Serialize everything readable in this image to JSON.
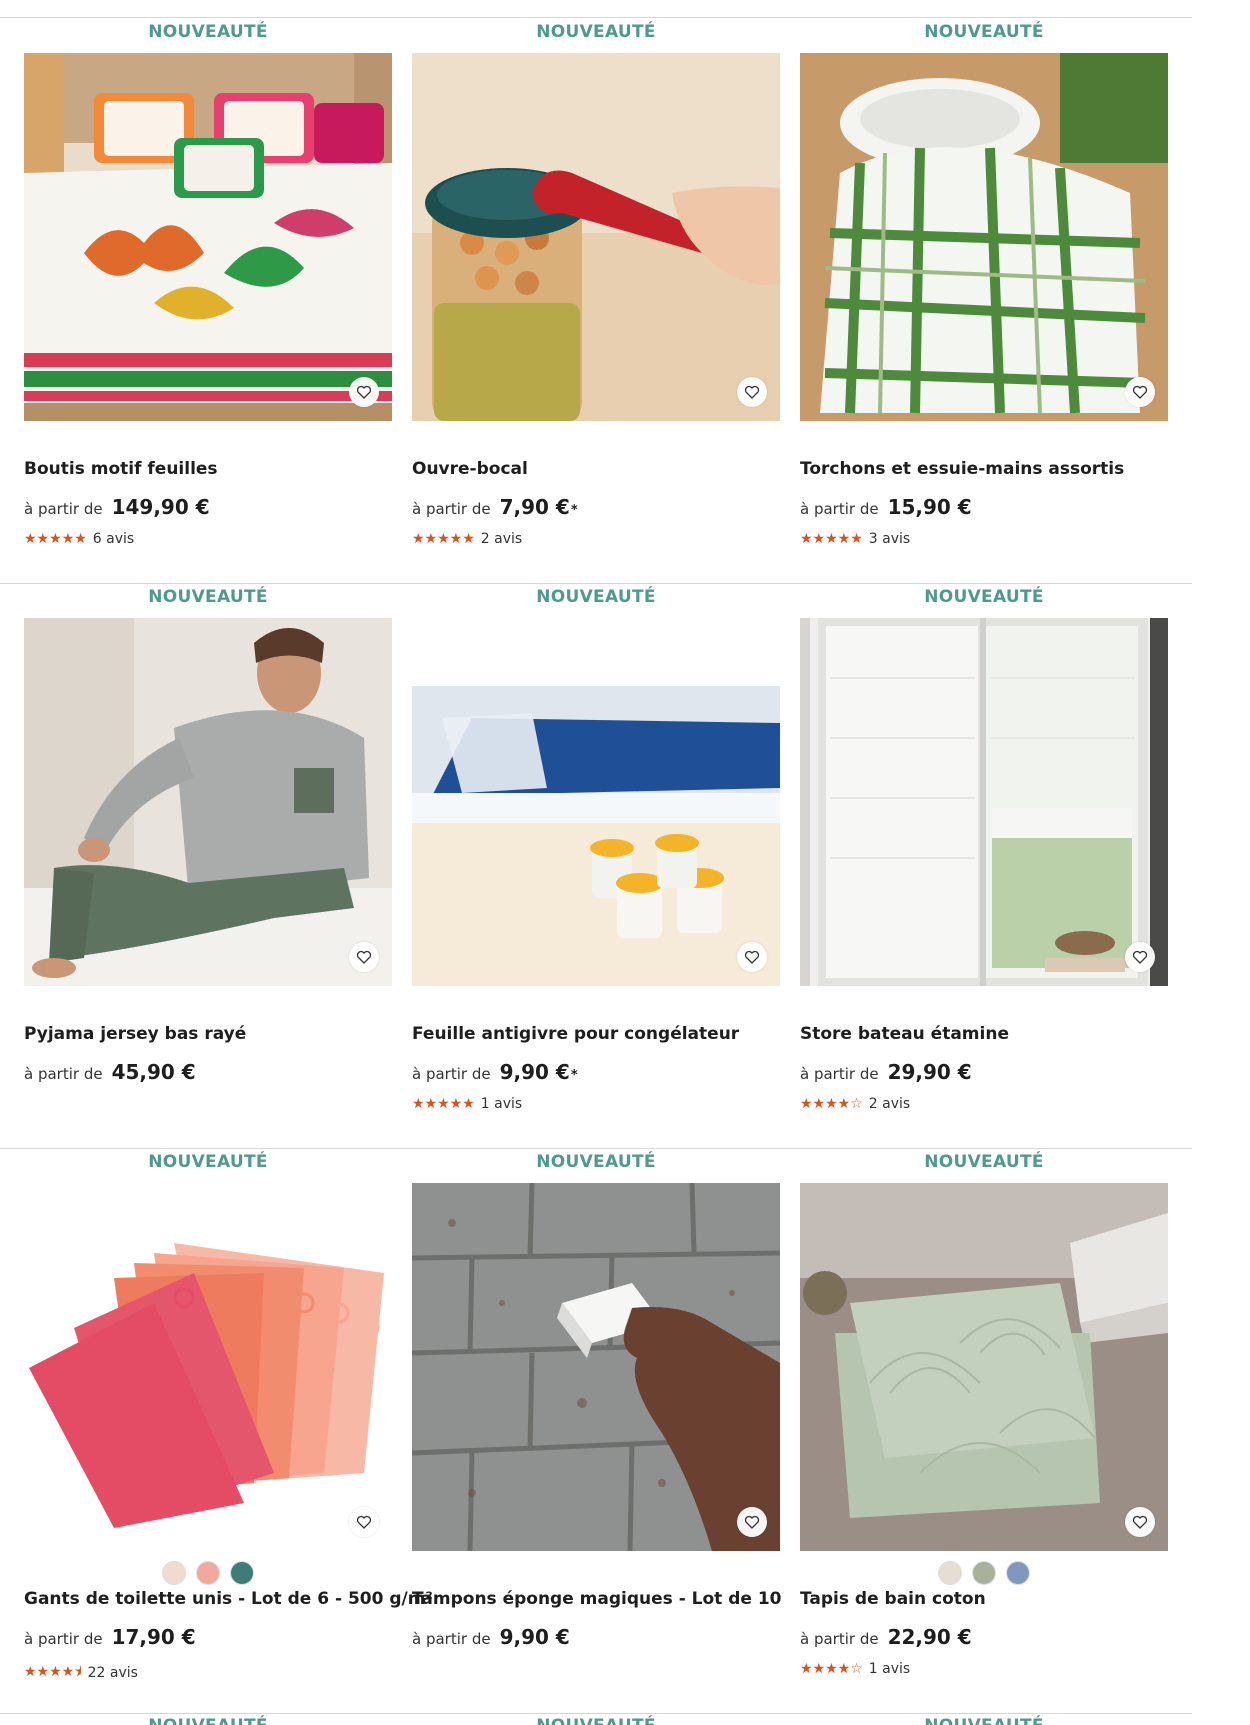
{
  "colors": {
    "badge": "#4e9a8e",
    "star": "#d8531e"
  },
  "badge_label": "NOUVEAUTÉ",
  "from_label": "à partir de",
  "products": [
    {
      "title": "Boutis motif feuilles",
      "price": "149,90 €",
      "asterisk": "",
      "stars": "★★★★★",
      "reviews": "6 avis"
    },
    {
      "title": "Ouvre-bocal",
      "price": "7,90 €",
      "asterisk": "*",
      "stars": "★★★★★",
      "reviews": "2 avis"
    },
    {
      "title": "Torchons et essuie-mains assortis",
      "price": "15,90 €",
      "asterisk": "",
      "stars": "★★★★★",
      "reviews": "3 avis"
    },
    {
      "title": "Pyjama jersey bas rayé",
      "price": "45,90 €",
      "asterisk": "",
      "stars": "",
      "reviews": ""
    },
    {
      "title": "Feuille antigivre pour congélateur",
      "price": "9,90 €",
      "asterisk": "*",
      "stars": "★★★★★",
      "reviews": "1 avis"
    },
    {
      "title": "Store bateau étamine",
      "price": "29,90 €",
      "asterisk": "",
      "stars": "★★★★☆",
      "reviews": "2 avis"
    },
    {
      "title": "Gants de toilette unis - Lot de 6 - 500 g/m²",
      "price": "17,90 €",
      "asterisk": "",
      "stars": "★★★★⯨",
      "reviews": "22 avis",
      "swatches": [
        "#efdccf",
        "#f1a99c",
        "#3d7c77"
      ]
    },
    {
      "title": "Tampons éponge magiques - Lot de 10",
      "price": "9,90 €",
      "asterisk": "",
      "stars": "",
      "reviews": ""
    },
    {
      "title": "Tapis de bain coton",
      "price": "22,90 €",
      "asterisk": "",
      "stars": "★★★★☆",
      "reviews": "1 avis",
      "swatches": [
        "#e6ddd3",
        "#a9b19a",
        "#7e98be"
      ]
    }
  ],
  "next_row_badge": "NOUVEAUTÉ"
}
